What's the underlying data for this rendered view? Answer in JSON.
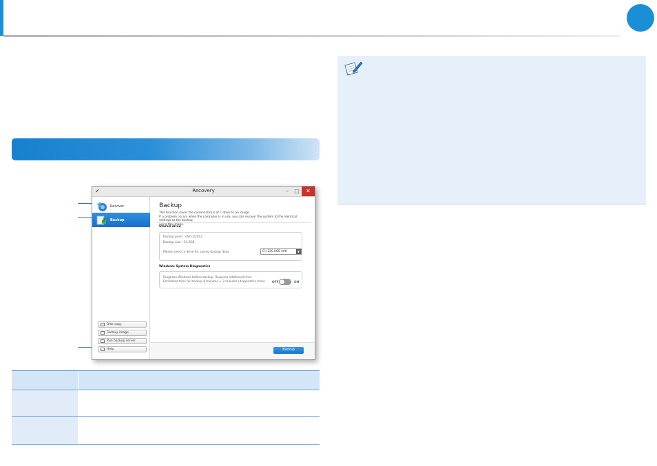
{
  "header": {
    "page_number": ""
  },
  "section": {
    "title": ""
  },
  "window": {
    "title": "Recovery",
    "minimize_glyph": "–",
    "maximize_glyph": "□",
    "close_glyph": "✕",
    "sidebar": {
      "items": [
        {
          "label": "Recover",
          "icon": "recover-icon"
        },
        {
          "label": "Backup",
          "icon": "backup-icon"
        }
      ],
      "buttons": [
        {
          "label": "Disk copy"
        },
        {
          "label": "Factory image"
        },
        {
          "label": "Run backup server"
        },
        {
          "label": "Help"
        }
      ]
    },
    "main": {
      "heading": "Backup",
      "desc_line1": "This function saves the current status of C drive to an image.",
      "desc_line2": "If a problem occurs while the computer is in use, you can recover the system to the identical settings as the backup",
      "desc_line3": "using the image.",
      "stored_drive": {
        "title": "Stored drive",
        "backup_point": "Backup point : 09/11/2012",
        "backup_size": "Backup size : 14.3GB",
        "prompt": "Please select a drive for saving backup data.",
        "selected_drive": "C\\ (250.0GB left)"
      },
      "diagnostics": {
        "title": "Windows System Diagnostics",
        "line1": "Diagnose Windows before backup. Requires additional time.",
        "line2": "Estimated time for backup 8 minutes + 2 minutes (diagnostics time)",
        "off_label": "OFF",
        "on_label": "ON",
        "enabled": false
      },
      "backup_button": "Backup"
    }
  },
  "table": {
    "header": [
      "",
      ""
    ],
    "rows": [
      [
        "",
        ""
      ],
      [
        "",
        ""
      ]
    ]
  },
  "colors": {
    "accent": "#1a8fd6",
    "table_header": "#d4e5f7",
    "note_bg": "#e6f0fa"
  }
}
